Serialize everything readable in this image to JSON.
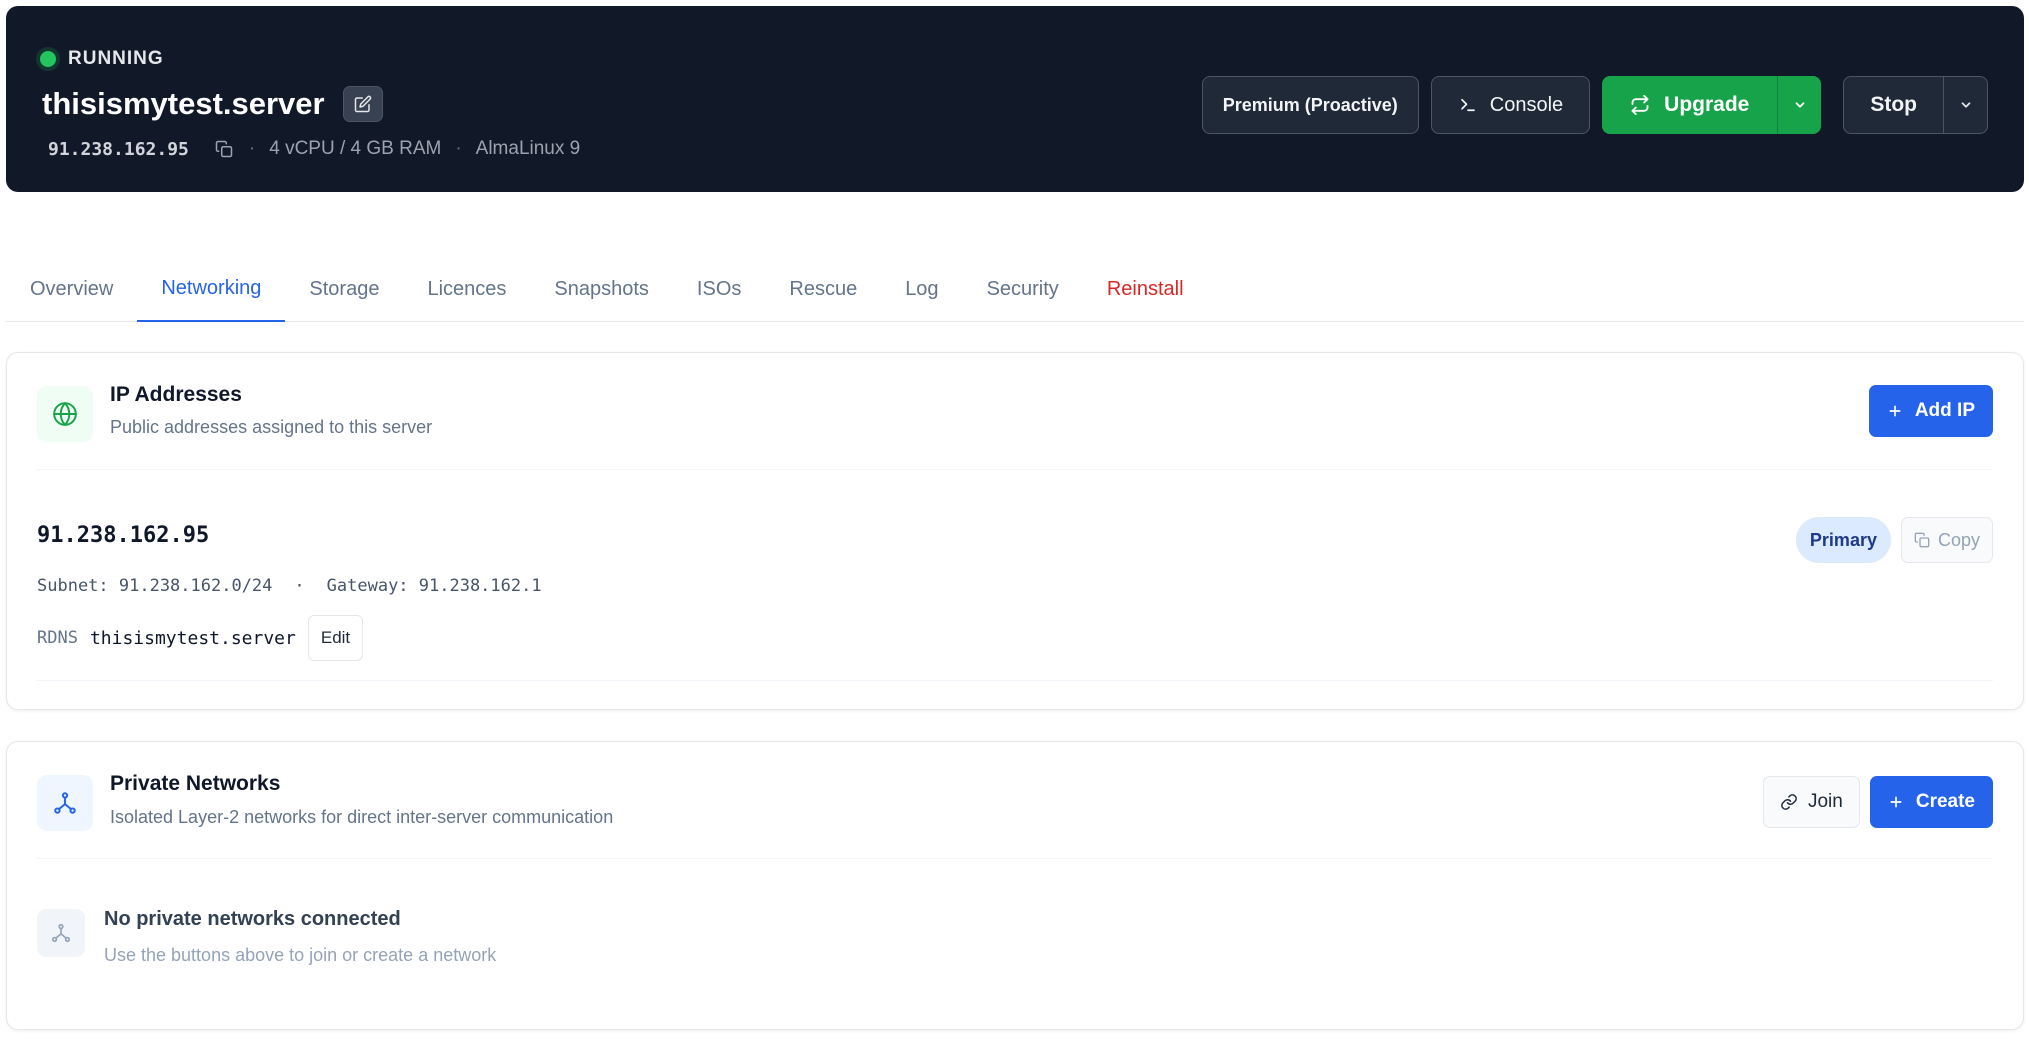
{
  "server": {
    "status": "RUNNING",
    "hostname": "thisismytest.server",
    "ip": "91.238.162.95",
    "spec": "4 vCPU / 4 GB RAM",
    "os": "AlmaLinux 9",
    "separator": "·"
  },
  "actions": {
    "plan": "Premium (Proactive)",
    "console": "Console",
    "upgrade": "Upgrade",
    "stop": "Stop"
  },
  "tabs": [
    {
      "label": "Overview"
    },
    {
      "label": "Networking"
    },
    {
      "label": "Storage"
    },
    {
      "label": "Licences"
    },
    {
      "label": "Snapshots"
    },
    {
      "label": "ISOs"
    },
    {
      "label": "Rescue"
    },
    {
      "label": "Log"
    },
    {
      "label": "Security"
    },
    {
      "label": "Reinstall"
    }
  ],
  "ip_section": {
    "title": "IP Addresses",
    "subtitle": "Public addresses assigned to this server",
    "add_label": "Add IP",
    "address": "91.238.162.95",
    "subnet": "Subnet: 91.238.162.0/24",
    "dot": "·",
    "gateway": "Gateway: 91.238.162.1",
    "rdns_label": "RDNS",
    "rdns_value": "thisismytest.server",
    "edit_label": "Edit",
    "badge": "Primary",
    "copy_label": "Copy"
  },
  "private_networks": {
    "title": "Private Networks",
    "subtitle": "Isolated Layer-2 networks for direct inter-server communication",
    "join_label": "Join",
    "create_label": "Create",
    "empty_title": "No private networks connected",
    "empty_subtitle": "Use the buttons above to join or create a network"
  },
  "icons": {
    "status": "status-dot",
    "edit": "pencil-square-icon",
    "copy": "copy-icon",
    "console": "terminal-icon",
    "upgrade": "arrows-exchange-icon",
    "caret": "chevron-down-icon",
    "globe": "globe-icon",
    "plus": "plus-icon",
    "link": "link-icon",
    "network": "network-nodes-icon"
  },
  "colors": {
    "header_bg": "#111827",
    "running": "#22c55e",
    "upgrade": "#16a34a",
    "accent": "#2563eb",
    "danger": "#dc2626"
  }
}
